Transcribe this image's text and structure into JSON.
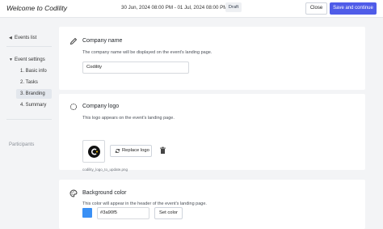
{
  "header": {
    "title": "Welcome to Codility",
    "date_range": "30 Jun, 2024 08:00 PM - 01 Jul, 2024 08:00 PM EDT",
    "status_badge": "Draft",
    "close_label": "Close",
    "save_label": "Save and continue"
  },
  "sidebar": {
    "events_list": "Events list",
    "event_settings": "Event settings",
    "items": [
      {
        "label": "1. Basic info",
        "active": false
      },
      {
        "label": "2. Tasks",
        "active": false
      },
      {
        "label": "3. Branding",
        "active": true
      },
      {
        "label": "4. Summary",
        "active": false
      }
    ],
    "participants": "Participants"
  },
  "company_name": {
    "title": "Company name",
    "description": "The company name will be displayed on the event's landing page.",
    "value": "Codility"
  },
  "company_logo": {
    "title": "Company logo",
    "description": "This logo appears on the event's landing page.",
    "replace_label": "Replace logo",
    "filename": "codility_logo_to_update.png"
  },
  "background_color": {
    "title": "Background color",
    "description": "This color will appear in the header of the event's landing page.",
    "value": "#3a90f5",
    "set_label": "Set color"
  },
  "colors": {
    "accent": "#4f5ce8",
    "swatch": "#3a90f5",
    "active_nav": "#e3e7ed"
  },
  "icons": [
    "chevron-left-icon",
    "chevron-down-icon",
    "pencil-icon",
    "logo-icon",
    "palette-icon",
    "refresh-icon",
    "trash-icon"
  ]
}
